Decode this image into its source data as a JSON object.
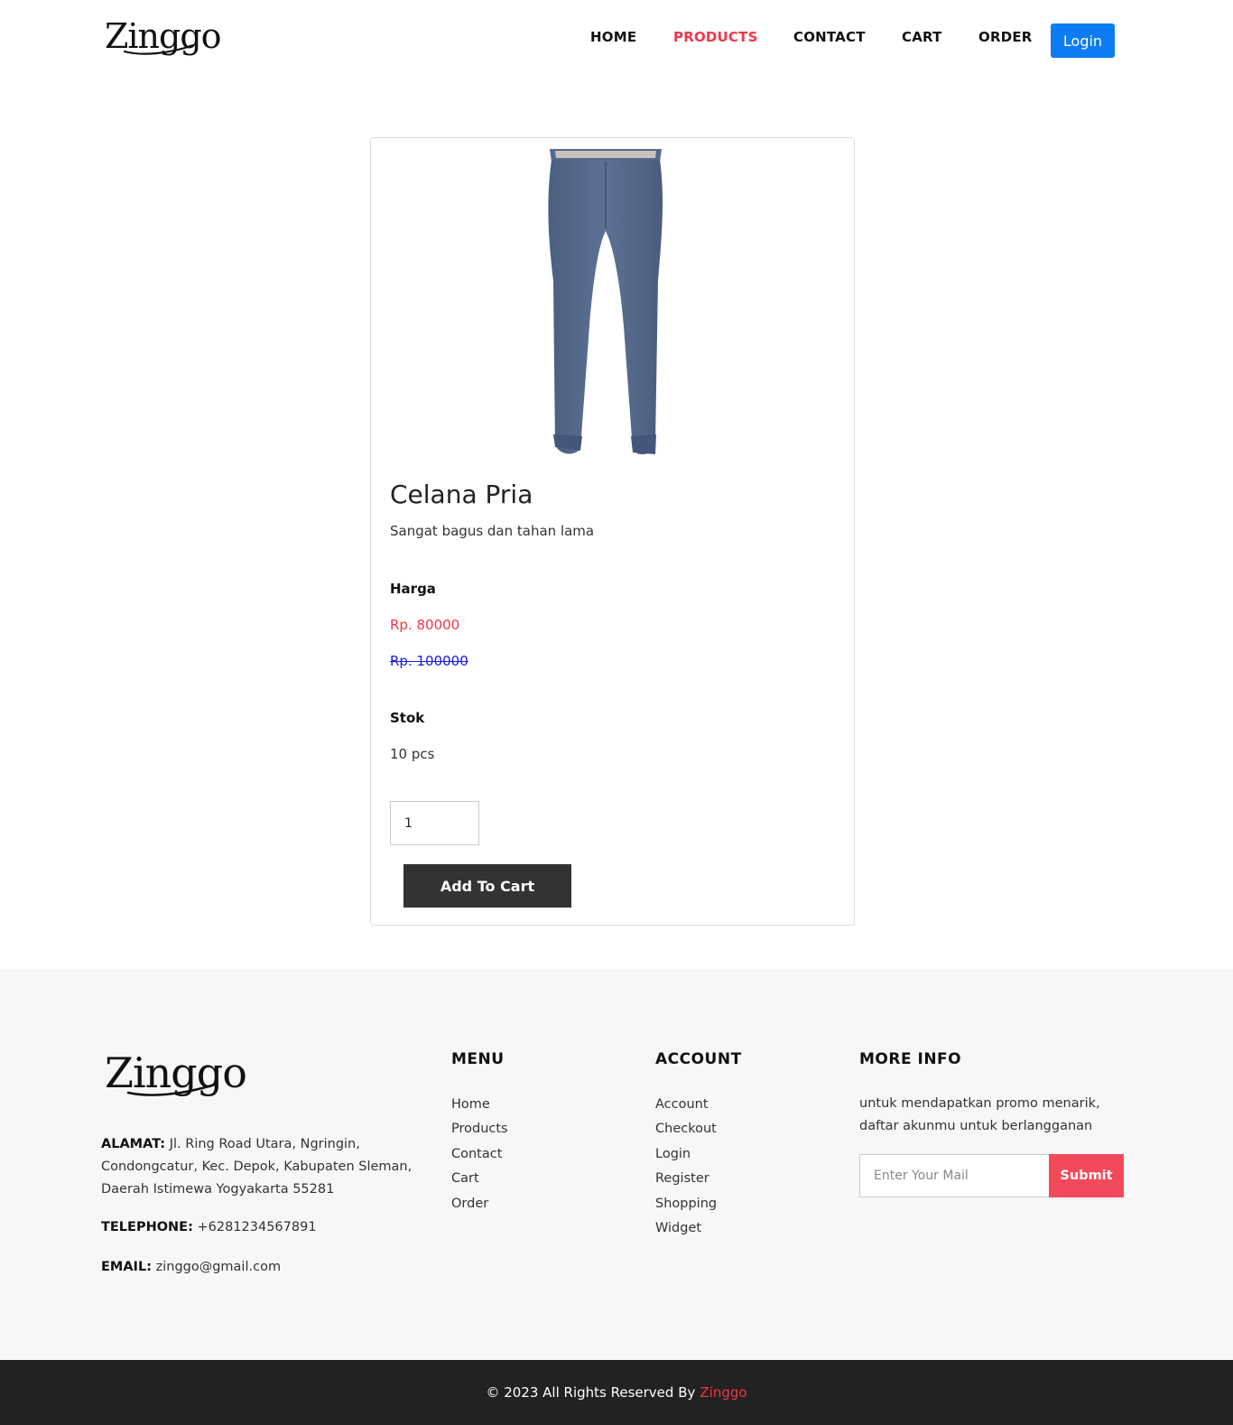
{
  "brand": {
    "name": "Zinggo"
  },
  "nav": {
    "items": [
      {
        "label": "HOME"
      },
      {
        "label": "PRODUCTS",
        "active": true
      },
      {
        "label": "CONTACT"
      },
      {
        "label": "CART"
      },
      {
        "label": "ORDER"
      }
    ],
    "login_label": "Login"
  },
  "product": {
    "name": "Celana Pria",
    "description": "Sangat bagus dan tahan lama",
    "price_label": "Harga",
    "price": "Rp. 80000",
    "price_old": "Rp. 100000",
    "stock_label": "Stok",
    "stock": "10 pcs",
    "quantity": "1",
    "add_to_cart_label": "Add To Cart"
  },
  "footer": {
    "address_label": "ALAMAT:",
    "address": "Jl. Ring Road Utara, Ngringin, Condongcatur, Kec. Depok, Kabupaten Sleman, Daerah Istimewa Yogyakarta 55281",
    "telephone_label": "TELEPHONE:",
    "telephone": "+6281234567891",
    "email_label": "EMAIL:",
    "email": "zinggo@gmail.com",
    "menu": {
      "title": "MENU",
      "items": [
        "Home",
        "Products",
        "Contact",
        "Cart",
        "Order"
      ]
    },
    "account": {
      "title": "ACCOUNT",
      "items": [
        "Account",
        "Checkout",
        "Login",
        "Register",
        "Shopping",
        "Widget"
      ]
    },
    "more_info": {
      "title": "MORE INFO",
      "text": "untuk mendapatkan promo menarik, daftar akunmu untuk berlangganan",
      "email_placeholder": "Enter Your Mail",
      "submit_label": "Submit"
    },
    "copyright": "© 2023 All Rights Reserved By",
    "copyright_brand": "Zinggo"
  },
  "colors": {
    "accent": "#f0374a",
    "primary_button": "#0d7cf2",
    "dark_button": "#333333",
    "footer_bg": "#f7f7f7",
    "bottom_bar": "#222222"
  }
}
